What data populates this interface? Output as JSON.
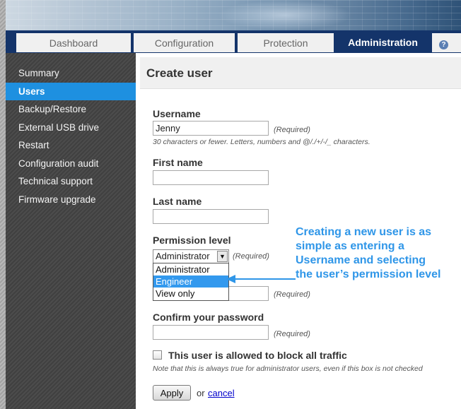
{
  "nav": {
    "tabs": [
      "Dashboard",
      "Configuration",
      "Protection",
      "Administration"
    ],
    "active_tab": "Administration",
    "help_icon": "help-icon"
  },
  "sidebar": {
    "items": [
      "Summary",
      "Users",
      "Backup/Restore",
      "External USB drive",
      "Restart",
      "Configuration audit",
      "Technical support",
      "Firmware upgrade"
    ],
    "active_item": "Users"
  },
  "main": {
    "title": "Create user"
  },
  "form": {
    "username": {
      "label": "Username",
      "value": "Jenny",
      "required": "(Required)",
      "hint": "30 characters or fewer. Letters, numbers and @/./+/-/_ characters."
    },
    "first_name": {
      "label": "First name",
      "value": ""
    },
    "last_name": {
      "label": "Last name",
      "value": ""
    },
    "permission": {
      "label": "Permission level",
      "selected": "Administrator",
      "required": "(Required)",
      "options": [
        "Administrator",
        "Engineer",
        "View only"
      ],
      "highlighted": "Engineer"
    },
    "password": {
      "required": "(Required)"
    },
    "confirm_password": {
      "label": "Confirm your password",
      "required": "(Required)"
    },
    "block_traffic": {
      "label": "This user is allowed to block all traffic",
      "note": "Note that this is always true for administrator users, even if this box is not checked",
      "checked": false
    },
    "apply_label": "Apply",
    "or_text": "or",
    "cancel_label": "cancel"
  },
  "callout": {
    "lines": [
      "Creating a new user is as",
      "simple as entering a",
      "Username and selecting",
      "the user’s permission level"
    ],
    "color": "#2f96e8"
  },
  "colors": {
    "nav_bg": "#14346a",
    "active_sidebar": "#1e90e0",
    "link": "#0000cc"
  }
}
